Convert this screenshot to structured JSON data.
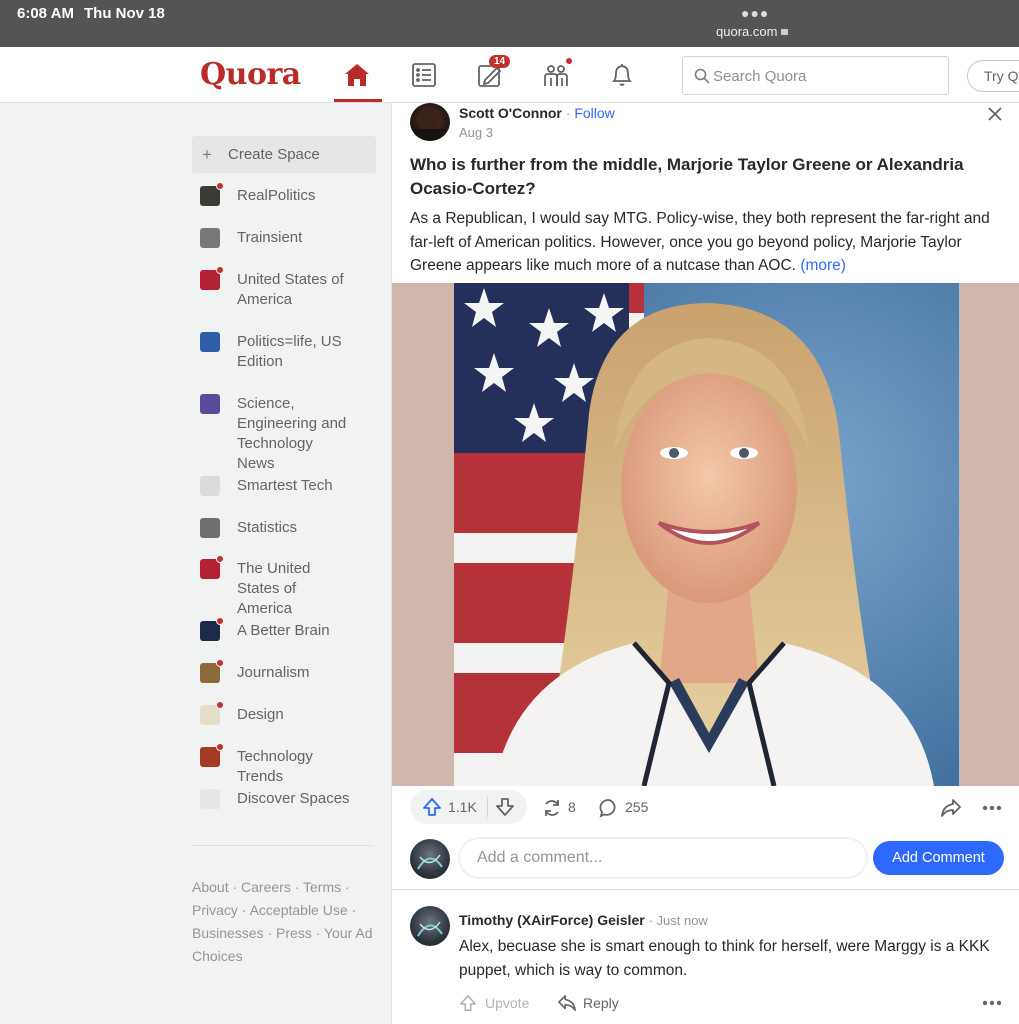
{
  "status_bar": {
    "time": "6:08 AM",
    "date": "Thu Nov 18",
    "url": "quora.com"
  },
  "header": {
    "logo": "Quora",
    "notifications_badge": "14",
    "search_placeholder": "Search Quora",
    "try_label": "Try Q"
  },
  "sidebar": {
    "create_space": "Create Space",
    "items": [
      {
        "label": "RealPolitics",
        "icon_color": "#3b3a35",
        "has_dot": true
      },
      {
        "label": "Trainsient",
        "icon_color": "#777777",
        "has_dot": false
      },
      {
        "label": "United States of America",
        "icon_color": "#b22234",
        "has_dot": true
      },
      {
        "label": "Politics=life, US Edition",
        "icon_color": "#2f5da8",
        "has_dot": false
      },
      {
        "label": "Science, Engineering and Technology News",
        "icon_color": "#5b4a9a",
        "has_dot": false
      },
      {
        "label": "Smartest Tech",
        "icon_color": "#d9dbdd",
        "has_dot": false
      },
      {
        "label": "Statistics",
        "icon_color": "#6c6e70",
        "has_dot": false
      },
      {
        "label": "The United States of America",
        "icon_color": "#b22234",
        "has_dot": true
      },
      {
        "label": "A Better Brain",
        "icon_color": "#1c2b4a",
        "has_dot": true
      },
      {
        "label": "Journalism",
        "icon_color": "#8a6a3a",
        "has_dot": true
      },
      {
        "label": "Design",
        "icon_color": "#e8ddc8",
        "has_dot": true
      },
      {
        "label": "Technology Trends",
        "icon_color": "#a33a22",
        "has_dot": true
      },
      {
        "label": "Discover Spaces",
        "icon_color": "#e4e6e8",
        "has_dot": false
      }
    ],
    "footer": "About · Careers · Terms · Privacy · Acceptable Use · Businesses · Press · Your Ad Choices"
  },
  "post": {
    "author": "Scott O'Connor",
    "separator": "·",
    "follow": "Follow",
    "date": "Aug 3",
    "question": "Who is further from the middle, Marjorie Taylor Greene or Alexandria Ocasio-Cortez?",
    "answer_preview": "As a Republican, I would say MTG. Policy-wise, they both represent the far-right and far-left of American politics. However, once you go beyond policy, Marjorie Taylor Greene appears like much more of a nutcase than AOC.",
    "more": "(more)",
    "upvotes": "1.1K",
    "shares": "8",
    "comments": "255"
  },
  "comment_box": {
    "placeholder": "Add a comment...",
    "button": "Add Comment"
  },
  "comment": {
    "author": "Timothy (XAirForce) Geisler",
    "time": "· Just now",
    "text": "Alex, becuase she is smart enough to think for herself, were Marggy is a KKK puppet, which is way to common.",
    "upvote": "Upvote",
    "reply": "Reply"
  }
}
